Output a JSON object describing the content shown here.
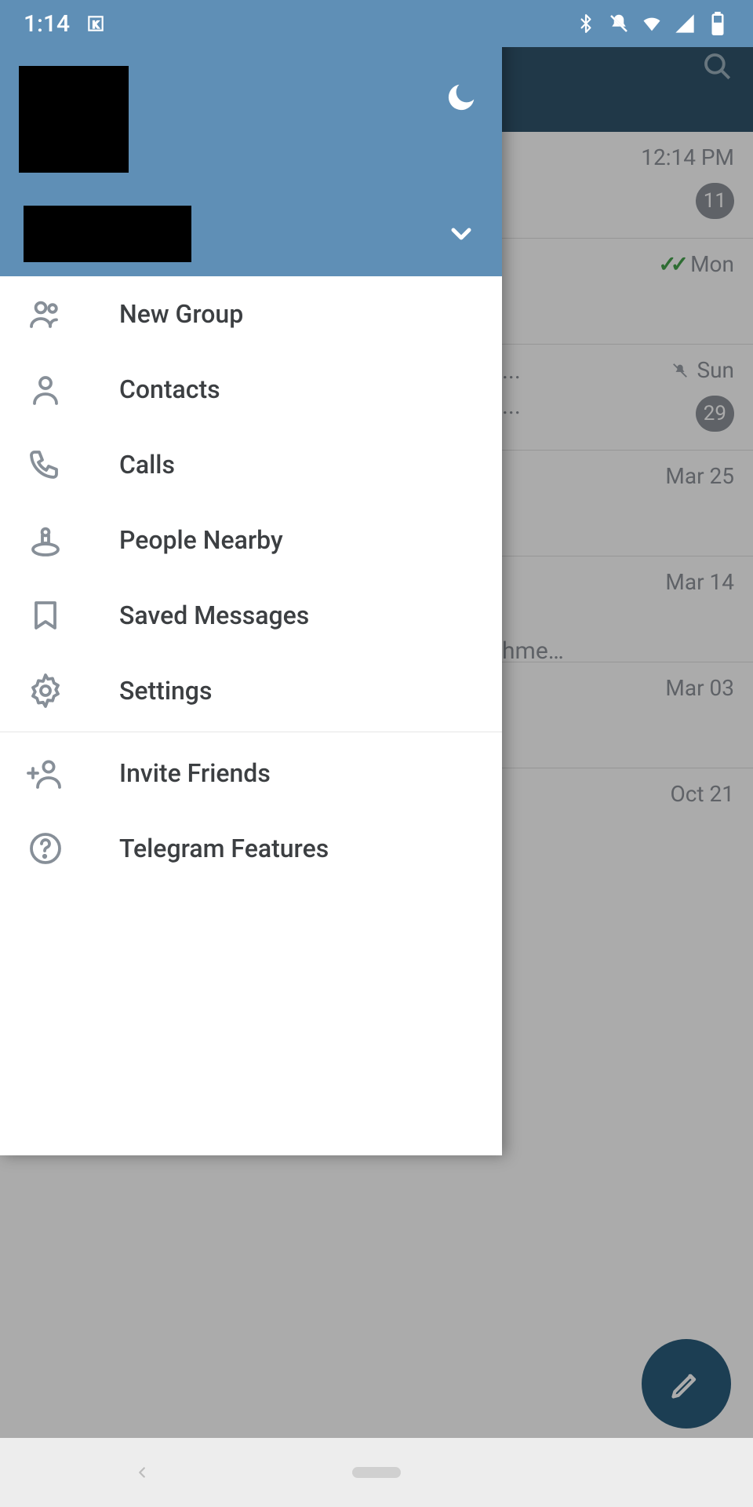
{
  "status": {
    "time": "1:14",
    "icons": [
      "bluetooth",
      "dnd-bell-off",
      "wifi",
      "signal",
      "battery"
    ]
  },
  "drawer": {
    "menu_main": [
      {
        "icon": "group",
        "label": "New Group"
      },
      {
        "icon": "person",
        "label": "Contacts"
      },
      {
        "icon": "phone",
        "label": "Calls"
      },
      {
        "icon": "nearby",
        "label": "People Nearby"
      },
      {
        "icon": "bookmark",
        "label": "Saved Messages"
      },
      {
        "icon": "gear",
        "label": "Settings"
      }
    ],
    "menu_secondary": [
      {
        "icon": "invite",
        "label": "Invite Friends"
      },
      {
        "icon": "help",
        "label": "Telegram Features"
      }
    ]
  },
  "chats": [
    {
      "time": "12:14 PM",
      "badge": "11"
    },
    {
      "time": "Mon",
      "read": true
    },
    {
      "time": "Sun",
      "badge": "29",
      "muted": true,
      "ellipsis_top": "...",
      "ellipsis_bottom": "..."
    },
    {
      "time": "Mar 25"
    },
    {
      "time": "Mar 14",
      "snippet": "hme…"
    },
    {
      "time": "Mar 03"
    },
    {
      "time": "Oct 21"
    }
  ]
}
